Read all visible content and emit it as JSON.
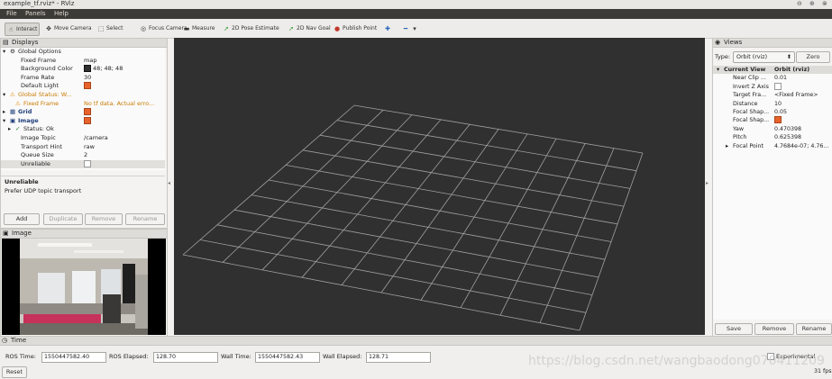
{
  "window": {
    "title": "example_tf.rviz* - RViz"
  },
  "menu": [
    "File",
    "Panels",
    "Help"
  ],
  "toolbar": [
    {
      "label": "Interact",
      "icon": "interact-icon",
      "glyph": "☝"
    },
    {
      "label": "Move Camera",
      "icon": "move-camera-icon",
      "glyph": "✥"
    },
    {
      "label": "Select",
      "icon": "select-icon",
      "glyph": "⬚"
    },
    {
      "label": "Focus Camera",
      "icon": "focus-camera-icon",
      "glyph": "◎"
    },
    {
      "label": "Measure",
      "icon": "measure-icon",
      "glyph": "▬"
    },
    {
      "label": "2D Pose Estimate",
      "icon": "pose-estimate-icon",
      "glyph": "➚"
    },
    {
      "label": "2D Nav Goal",
      "icon": "nav-goal-icon",
      "glyph": "➚"
    },
    {
      "label": "Publish Point",
      "icon": "publish-point-icon",
      "glyph": "📍"
    }
  ],
  "displays": {
    "title": "Displays",
    "rows": [
      {
        "name": "Global Options",
        "value": "",
        "style": "",
        "indent": 1,
        "arrow": "▾",
        "icon": "⚙"
      },
      {
        "name": "Fixed Frame",
        "value": "map",
        "style": "",
        "indent": 3,
        "arrow": "",
        "icon": ""
      },
      {
        "name": "Background Color",
        "value": "48; 48; 48",
        "style": "",
        "indent": 3,
        "arrow": "",
        "icon": "",
        "swatch": "#303030"
      },
      {
        "name": "Frame Rate",
        "value": "30",
        "style": "",
        "indent": 3,
        "arrow": "",
        "icon": ""
      },
      {
        "name": "Default Light",
        "value": "",
        "style": "",
        "indent": 3,
        "arrow": "",
        "icon": "",
        "check": true
      },
      {
        "name": "Global Status: W...",
        "value": "",
        "style": "orange",
        "indent": 1,
        "arrow": "▾",
        "icon": "⚠"
      },
      {
        "name": "Fixed Frame",
        "value": "No tf data.  Actual erro...",
        "style": "orange",
        "indent": 2,
        "arrow": "",
        "icon": "⚠"
      },
      {
        "name": "Grid",
        "value": "",
        "style": "blue",
        "indent": 1,
        "arrow": "▸",
        "icon": "▦",
        "check": true
      },
      {
        "name": "Image",
        "value": "",
        "style": "blue",
        "indent": 1,
        "arrow": "▾",
        "icon": "▣",
        "check": true
      },
      {
        "name": "Status: Ok",
        "value": "",
        "style": "",
        "indent": 2,
        "arrow": "▸",
        "icon": "✓"
      },
      {
        "name": "Image Topic",
        "value": "/camera",
        "style": "",
        "indent": 3,
        "arrow": "",
        "icon": ""
      },
      {
        "name": "Transport Hint",
        "value": "raw",
        "style": "",
        "indent": 3,
        "arrow": "",
        "icon": ""
      },
      {
        "name": "Queue Size",
        "value": "2",
        "style": "",
        "indent": 3,
        "arrow": "",
        "icon": ""
      },
      {
        "name": "Unreliable",
        "value": "",
        "style": "",
        "indent": 3,
        "arrow": "",
        "icon": "",
        "check": false,
        "selected": true
      }
    ],
    "description_title": "Unreliable",
    "description_text": "Prefer UDP topic transport",
    "buttons": [
      "Add",
      "Duplicate",
      "Remove",
      "Rename"
    ]
  },
  "image_panel": {
    "title": "Image"
  },
  "views": {
    "title": "Views",
    "type_label": "Type:",
    "type_value": "Orbit (rviz)",
    "zero_label": "Zero",
    "rows": [
      {
        "name": "Current View",
        "value": "Orbit (rviz)",
        "header": true
      },
      {
        "name": "Near Clip ...",
        "value": "0.01"
      },
      {
        "name": "Invert Z Axis",
        "value": "",
        "check": false
      },
      {
        "name": "Target Fra...",
        "value": "<Fixed Frame>"
      },
      {
        "name": "Distance",
        "value": "10"
      },
      {
        "name": "Focal Shap...",
        "value": "0.05"
      },
      {
        "name": "Focal Shap...",
        "value": "",
        "check": true
      },
      {
        "name": "Yaw",
        "value": "0.470398"
      },
      {
        "name": "Pitch",
        "value": "0.625398"
      },
      {
        "name": "Focal Point",
        "value": "4.7684e-07; 4.76...",
        "expand": true
      }
    ],
    "buttons": [
      "Save",
      "Remove",
      "Rename"
    ]
  },
  "time": {
    "title": "Time",
    "ros_time_label": "ROS Time:",
    "ros_time": "1550447582.40",
    "ros_elapsed_label": "ROS Elapsed:",
    "ros_elapsed": "128.70",
    "wall_time_label": "Wall Time:",
    "wall_time": "1550447582.43",
    "wall_elapsed_label": "Wall Elapsed:",
    "wall_elapsed": "128.71",
    "experimental_label": "Experimental",
    "reset_label": "Reset",
    "fps": "31 fps"
  },
  "watermark": "https://blog.csdn.net/wangbaodong070411209"
}
